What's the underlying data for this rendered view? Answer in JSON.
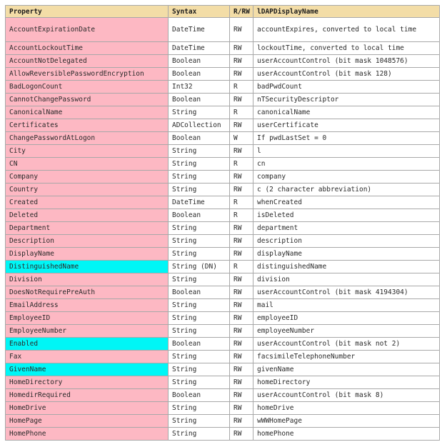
{
  "headers": {
    "property": "Property",
    "syntax": "Syntax",
    "rw": "R/RW",
    "ldap": "lDAPDisplayName"
  },
  "rows": [
    {
      "property": "AccountExpirationDate",
      "syntax": "DateTime",
      "rw": "RW",
      "ldap": "accountExpires, converted to local time",
      "highlight": false
    },
    {
      "property": "AccountLockoutTime",
      "syntax": "DateTime",
      "rw": "RW",
      "ldap": "lockoutTime, converted to local time",
      "highlight": false
    },
    {
      "property": "AccountNotDelegated",
      "syntax": "Boolean",
      "rw": "RW",
      "ldap": "userAccountControl (bit mask 1048576)",
      "highlight": false
    },
    {
      "property": "AllowReversiblePasswordEncryption",
      "syntax": "Boolean",
      "rw": "RW",
      "ldap": "userAccountControl (bit mask 128)",
      "highlight": false
    },
    {
      "property": "BadLogonCount",
      "syntax": "Int32",
      "rw": "R",
      "ldap": "badPwdCount",
      "highlight": false
    },
    {
      "property": "CannotChangePassword",
      "syntax": "Boolean",
      "rw": "RW",
      "ldap": "nTSecurityDescriptor",
      "highlight": false
    },
    {
      "property": "CanonicalName",
      "syntax": "String",
      "rw": "R",
      "ldap": "canonicalName",
      "highlight": false
    },
    {
      "property": "Certificates",
      "syntax": "ADCollection",
      "rw": "RW",
      "ldap": "userCertificate",
      "highlight": false
    },
    {
      "property": "ChangePasswordAtLogon",
      "syntax": "Boolean",
      "rw": "W",
      "ldap": "If pwdLastSet = 0",
      "highlight": false
    },
    {
      "property": "City",
      "syntax": "String",
      "rw": "RW",
      "ldap": "l",
      "highlight": false
    },
    {
      "property": "CN",
      "syntax": "String",
      "rw": "R",
      "ldap": "cn",
      "highlight": false
    },
    {
      "property": "Company",
      "syntax": "String",
      "rw": "RW",
      "ldap": "company",
      "highlight": false
    },
    {
      "property": "Country",
      "syntax": "String",
      "rw": "RW",
      "ldap": "c (2 character abbreviation)",
      "highlight": false
    },
    {
      "property": "Created",
      "syntax": "DateTime",
      "rw": "R",
      "ldap": "whenCreated",
      "highlight": false
    },
    {
      "property": "Deleted",
      "syntax": "Boolean",
      "rw": "R",
      "ldap": "isDeleted",
      "highlight": false
    },
    {
      "property": "Department",
      "syntax": "String",
      "rw": "RW",
      "ldap": "department",
      "highlight": false
    },
    {
      "property": "Description",
      "syntax": "String",
      "rw": "RW",
      "ldap": "description",
      "highlight": false
    },
    {
      "property": "DisplayName",
      "syntax": "String",
      "rw": "RW",
      "ldap": "displayName",
      "highlight": false
    },
    {
      "property": "DistinguishedName",
      "syntax": "String (DN)",
      "rw": "R",
      "ldap": "distinguishedName",
      "highlight": true
    },
    {
      "property": "Division",
      "syntax": "String",
      "rw": "RW",
      "ldap": "division",
      "highlight": false
    },
    {
      "property": "DoesNotRequirePreAuth",
      "syntax": "Boolean",
      "rw": "RW",
      "ldap": "userAccountControl (bit mask 4194304)",
      "highlight": false
    },
    {
      "property": "EmailAddress",
      "syntax": "String",
      "rw": "RW",
      "ldap": "mail",
      "highlight": false
    },
    {
      "property": "EmployeeID",
      "syntax": "String",
      "rw": "RW",
      "ldap": "employeeID",
      "highlight": false
    },
    {
      "property": "EmployeeNumber",
      "syntax": "String",
      "rw": "RW",
      "ldap": "employeeNumber",
      "highlight": false
    },
    {
      "property": "Enabled",
      "syntax": "Boolean",
      "rw": "RW",
      "ldap": "userAccountControl (bit mask not 2)",
      "highlight": true
    },
    {
      "property": "Fax",
      "syntax": "String",
      "rw": "RW",
      "ldap": "facsimileTelephoneNumber",
      "highlight": false
    },
    {
      "property": "GivenName",
      "syntax": "String",
      "rw": "RW",
      "ldap": "givenName",
      "highlight": true
    },
    {
      "property": "HomeDirectory",
      "syntax": "String",
      "rw": "RW",
      "ldap": "homeDirectory",
      "highlight": false
    },
    {
      "property": "HomedirRequired",
      "syntax": "Boolean",
      "rw": "RW",
      "ldap": "userAccountControl (bit mask 8)",
      "highlight": false
    },
    {
      "property": "HomeDrive",
      "syntax": "String",
      "rw": "RW",
      "ldap": "homeDrive",
      "highlight": false
    },
    {
      "property": "HomePage",
      "syntax": "String",
      "rw": "RW",
      "ldap": "wWWHomePage",
      "highlight": false
    },
    {
      "property": "HomePhone",
      "syntax": "String",
      "rw": "RW",
      "ldap": "homePhone",
      "highlight": false
    }
  ],
  "colors": {
    "header_bg": "#f3dda7",
    "property_bg": "#fdb8c3",
    "highlight_bg": "#00f6f6",
    "border": "#a8a8a8"
  }
}
